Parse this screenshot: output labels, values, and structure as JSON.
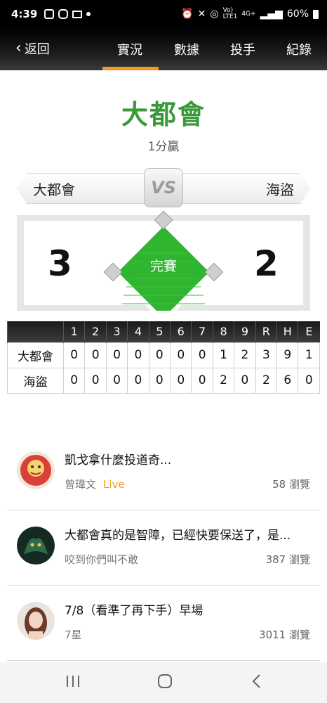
{
  "status_bar": {
    "time": "4:39",
    "battery": "60%",
    "network": "4G+",
    "volte": "Vo)",
    "lte": "LTE1"
  },
  "nav": {
    "back_label": "返回",
    "tabs": [
      "實況",
      "數據",
      "投手",
      "紀錄"
    ],
    "active_tab": 0
  },
  "game": {
    "winner": "大都會",
    "margin": "1分贏",
    "vs": "VS",
    "away_team": "大都會",
    "home_team": "海盜",
    "away_score": "3",
    "home_score": "2",
    "status": "完賽"
  },
  "linescore": {
    "headers": [
      "1",
      "2",
      "3",
      "4",
      "5",
      "6",
      "7",
      "8",
      "9",
      "R",
      "H",
      "E"
    ],
    "rows": [
      {
        "team": "大都會",
        "cells": [
          "0",
          "0",
          "0",
          "0",
          "0",
          "0",
          "0",
          "1",
          "2",
          "3",
          "9",
          "1"
        ]
      },
      {
        "team": "海盜",
        "cells": [
          "0",
          "0",
          "0",
          "0",
          "0",
          "0",
          "0",
          "2",
          "0",
          "2",
          "6",
          "0"
        ]
      }
    ]
  },
  "posts": [
    {
      "title": "凱戈拿什麼投道奇...",
      "author": "曾瑋文",
      "live": "Live",
      "views": "58 瀏覽"
    },
    {
      "title": "大都會真的是智障，已經快要保送了，是...",
      "author": "咬到你們叫不敢",
      "live": "",
      "views": "387 瀏覽"
    },
    {
      "title": "7/8（看準了再下手）早場",
      "author": "7星",
      "live": "",
      "views": "3011 瀏覽"
    }
  ],
  "colors": {
    "accent": "#f39a1e",
    "winner_green": "#3a9a3a",
    "field_green": "#2fb52f"
  }
}
